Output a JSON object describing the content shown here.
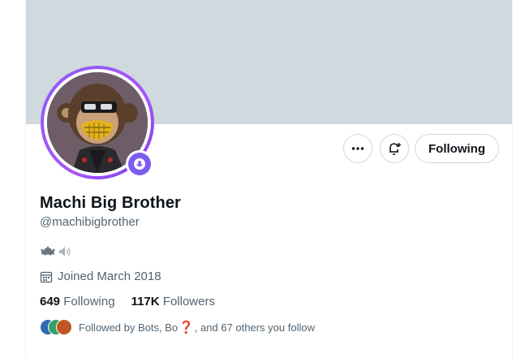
{
  "profile": {
    "display_name": "Machi Big Brother",
    "handle": "@machibigbrother",
    "joined": "Joined March 2018",
    "following_count": "649",
    "following_label": "Following",
    "followers_count": "117K",
    "followers_label": "Followers"
  },
  "actions": {
    "more_icon": "more-horizontal-icon",
    "notify_icon": "bell-plus-icon",
    "follow_label": "Following"
  },
  "bio": {
    "emojis": [
      "bat-icon",
      "speaker-icon"
    ]
  },
  "followed_by": {
    "prefix": "Followed by Bots, Bo",
    "emoji": "❓",
    "suffix": ", and 67 others you follow"
  },
  "colors": {
    "banner": "#cfd9de",
    "avatar_ring": "#8b5cf6",
    "badge": "#7c5cf0",
    "text_primary": "#0f1419",
    "text_secondary": "#536471"
  }
}
